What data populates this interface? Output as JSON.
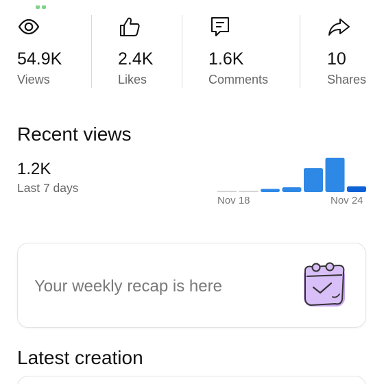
{
  "stats": [
    {
      "icon": "eye-icon",
      "value": "54.9K",
      "label": "Views"
    },
    {
      "icon": "thumbs-up-icon",
      "value": "2.4K",
      "label": "Likes"
    },
    {
      "icon": "comment-icon",
      "value": "1.6K",
      "label": "Comments"
    },
    {
      "icon": "share-icon",
      "value": "10",
      "label": "Shares"
    }
  ],
  "recent_views": {
    "title": "Recent views",
    "value": "1.2K",
    "period": "Last 7 days",
    "start_label": "Nov 18",
    "end_label": "Nov 24",
    "daily_values": [
      1,
      1,
      6,
      9,
      46,
      66,
      11
    ],
    "bar_color": "#2e88e5",
    "last_bar_color": "#0f62d6",
    "empty_color": "#cfcfcf"
  },
  "recap": {
    "text": "Your weekly recap is here",
    "icon": "calendar-check-icon"
  },
  "latest": {
    "title": "Latest creation"
  }
}
